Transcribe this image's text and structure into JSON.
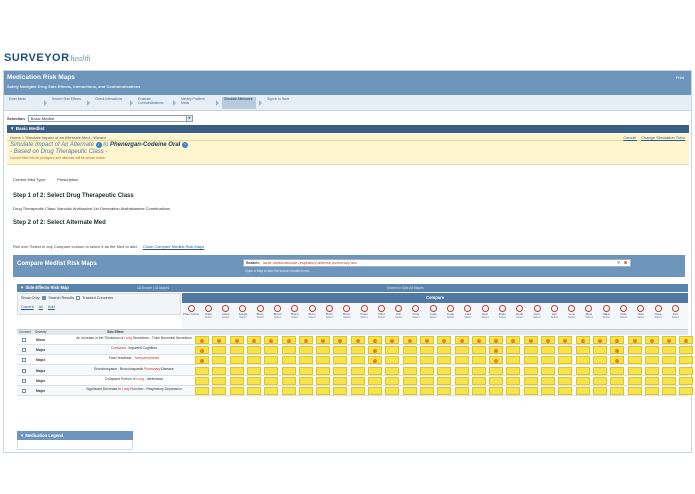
{
  "logo": {
    "main": "SURVEYOR",
    "sub": "health"
  },
  "header": {
    "title": "Medication Risk Maps",
    "subtitle": "Safely Navigate Drug Side Effects, Interactions, and Contraindications",
    "print": "Print"
  },
  "wizard": {
    "steps": [
      {
        "label": "Enter Meds"
      },
      {
        "label": "Search Side Effects"
      },
      {
        "label": "Check Interactions"
      },
      {
        "label": "Evaluate Contraindications"
      },
      {
        "label": "Identify Problem Meds"
      },
      {
        "label": "Simulate Alternates"
      },
      {
        "label": "Sign In to Save"
      }
    ],
    "active_index": 5
  },
  "selection": {
    "label": "Selection",
    "value": "Basic Medlist"
  },
  "section": {
    "title": "Basic Medlist"
  },
  "breadcrumb": {
    "text": "Home > Simulate Impact of an Alternate Med - Wizard",
    "cancel": "Cancel",
    "tutor": "Change Simulation Tutor"
  },
  "simulate": {
    "prefix": "Simulate Impact of An Alternate",
    "to": "to",
    "drug": "Phenergan-Codeine Oral",
    "based_on": "- Based on Drug Therapeutic Class -",
    "note": "Current Med info for prosigace and alternate will be shown below"
  },
  "current_med": {
    "label": "Current Med Type:",
    "value": "Prescription"
  },
  "step1": {
    "title": "Step 1 of 2: Select Drug Therapeutic Class",
    "line": "Drug Therapeutic Class: Narcotic Antitussive-1st Generation Antihistamine Combinations"
  },
  "step2": {
    "title": "Step 2 of 2: Select Alternate Med"
  },
  "rollover": {
    "text": "Roll over Select in any Compare column to select it as the Med to add.",
    "link": "Close Compare Medlist Risk Maps"
  },
  "compare_bar": {
    "title": "Compare Medlist Risk Maps",
    "search_label": "Search:",
    "search_value": "lactic cardiovascular-respiratory adverse pulmonary dcs",
    "hint": "Open a Map to see the search results in red."
  },
  "side_effects": {
    "title": "Side Effects Risk Map",
    "count1": "18 Bronze | 34 Majors",
    "count2": "Search in Side All Majors"
  },
  "show_only": {
    "label": "Show Only:",
    "opt1": "Search Results",
    "opt2": "Tracked Concerns",
    "links": [
      "Current",
      "All",
      "Add"
    ]
  },
  "compare_header": "Compare",
  "drugs": [
    {
      "name": "Phen Current",
      "sel": ""
    },
    {
      "name": "Hista",
      "sel": "Select"
    },
    {
      "name": "Actec",
      "sel": "Select"
    },
    {
      "name": "Antiga",
      "sel": "Select"
    },
    {
      "name": "Brom",
      "sel": "Select"
    },
    {
      "name": "Bromi",
      "sel": "Select"
    },
    {
      "name": "Bromi",
      "sel": "Select"
    },
    {
      "name": "Brom",
      "sel": "Select"
    },
    {
      "name": "Brom",
      "sel": "Select"
    },
    {
      "name": "Brom",
      "sel": "Select"
    },
    {
      "name": "Chem",
      "sel": "Select"
    },
    {
      "name": "Chlor",
      "sel": "Select"
    },
    {
      "name": "Clin",
      "sel": "Select"
    },
    {
      "name": "Chlor",
      "sel": "Select"
    },
    {
      "name": "Code",
      "sel": "Select"
    },
    {
      "name": "Code",
      "sel": "Select"
    },
    {
      "name": "Cola",
      "sel": "Select"
    },
    {
      "name": "Dexi",
      "sel": "Select"
    },
    {
      "name": "Endo",
      "sel": "Select"
    },
    {
      "name": "Endo",
      "sel": "Select"
    },
    {
      "name": "Genr",
      "sel": "Select"
    },
    {
      "name": "Hyc",
      "sel": "Select"
    },
    {
      "name": "Lora",
      "sel": "Select"
    },
    {
      "name": "Myte",
      "sel": "Select"
    },
    {
      "name": "Nalar",
      "sel": "Select"
    },
    {
      "name": "Nole",
      "sel": "Select"
    },
    {
      "name": "Notu",
      "sel": "Select"
    },
    {
      "name": "Nova",
      "sel": "Select"
    },
    {
      "name": "Pen",
      "sel": "Select"
    }
  ],
  "table": {
    "headers": {
      "concern": "Concern",
      "severity": "Severity",
      "effect": "Side Effect",
      "compare": ""
    },
    "rows": [
      {
        "severity": "Minor",
        "effect_a": "An Increase in the Thickness of ",
        "effect_r": "Lung",
        "effect_b": " Secretions - Thick Bronchial Secretions",
        "dots": [
          0,
          1,
          2,
          3,
          4,
          5,
          6,
          7,
          8,
          9,
          10,
          11,
          12,
          13,
          14,
          15,
          16,
          17,
          18,
          19,
          20,
          21,
          22,
          23,
          24,
          25,
          26,
          27,
          28
        ]
      },
      {
        "severity": "Major",
        "effect_a": "",
        "effect_r": "Confused",
        "effect_b": " - Impaired Cognition",
        "dots": [
          0,
          10,
          17,
          24
        ]
      },
      {
        "severity": "Major",
        "effect_a": "Fast Heartbeat - ",
        "effect_r": "Tachyarrhythmia",
        "effect_b": "",
        "dots": [
          0,
          10,
          17,
          24
        ]
      },
      {
        "severity": "Major",
        "effect_a": "Bronchospasm - Bronchospastic ",
        "effect_r": "Pulmonary",
        "effect_b": " Disease",
        "dots": []
      },
      {
        "severity": "Major",
        "effect_a": "Collapsed Portion of ",
        "effect_r": "Lung",
        "effect_b": " - Atelectasis",
        "dots": []
      },
      {
        "severity": "Major",
        "effect_a": "Significant Decrease in ",
        "effect_r": "Lung",
        "effect_b": " Function - Respiratory Depression",
        "dots": []
      }
    ]
  },
  "legend": {
    "title": "Medication Legend"
  }
}
